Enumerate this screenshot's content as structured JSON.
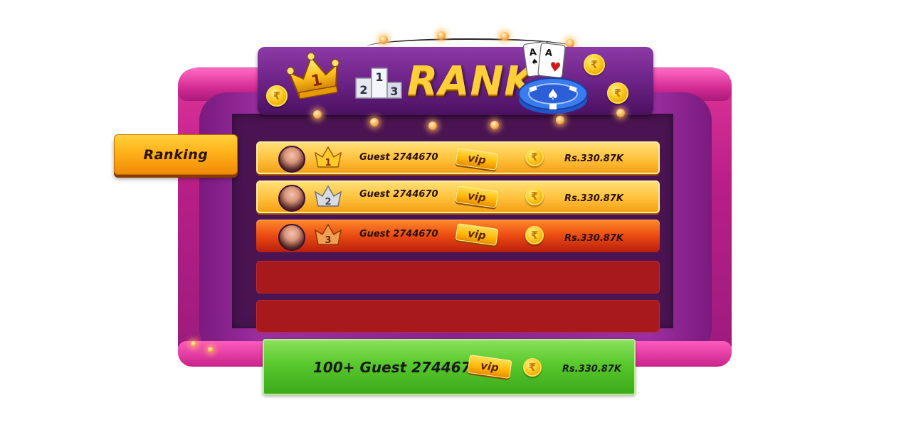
{
  "header": {
    "title": "RANK"
  },
  "tabs": [
    {
      "label": "Ranking",
      "active": true
    }
  ],
  "podium": {
    "labels": [
      "2",
      "1",
      "3"
    ]
  },
  "cards": {
    "rank": "A"
  },
  "rows": [
    {
      "rank": "1",
      "name": "Guest 2744670",
      "vip": "vip",
      "amount": "Rs.330.87K",
      "style": "gold"
    },
    {
      "rank": "2",
      "name": "Guest 2744670",
      "vip": "vip",
      "amount": "Rs.330.87K",
      "style": "gold"
    },
    {
      "rank": "3",
      "name": "Guest 2744670",
      "vip": "vip",
      "amount": "Rs.330.87K",
      "style": "orange"
    }
  ],
  "self": {
    "label": "100+ Guest 2744670",
    "vip": "vip",
    "amount": "Rs.330.87K"
  },
  "colors": {
    "gold": "#ffc03a",
    "orange": "#ea4a12",
    "empty_row": "#a8191d",
    "self_bar": "#58c82c",
    "stage": "#8a2292",
    "title": "#ffcf3a"
  }
}
